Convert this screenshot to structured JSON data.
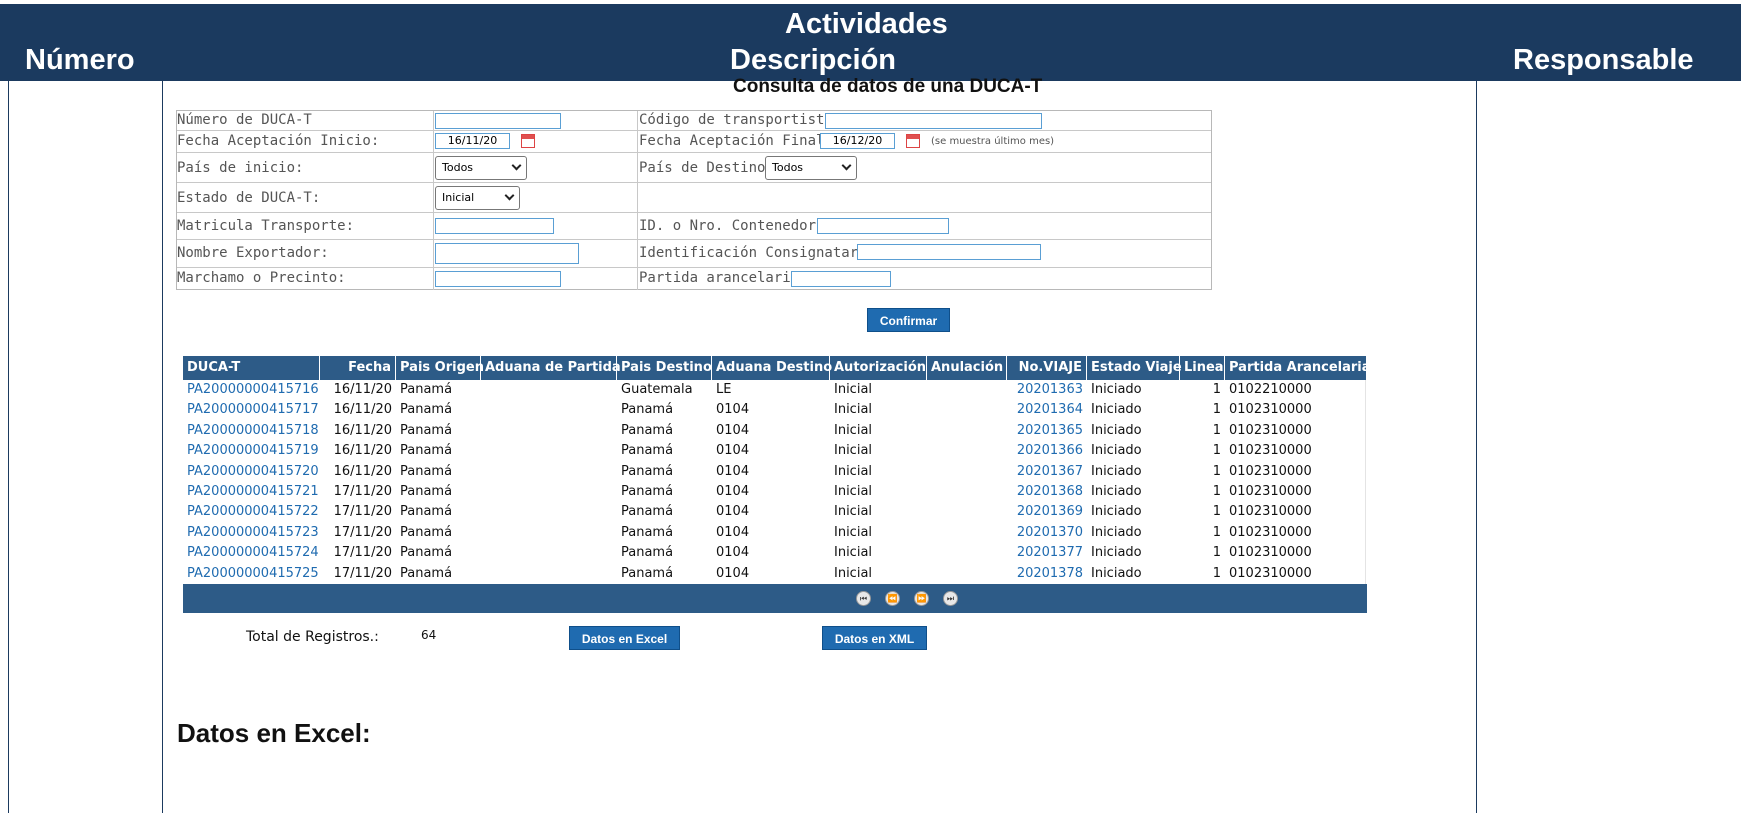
{
  "header": {
    "numero": "Número",
    "actividades": "Actividades",
    "descripcion": "Descripción",
    "responsable": "Responsable"
  },
  "page_title": "Consulta de datos de una DUCA-T",
  "form": {
    "numero_duca_label": "Número de DUCA-T",
    "numero_duca_value": "",
    "codigo_transportista_label": "Código de transportista:",
    "codigo_transportista_value": "",
    "fecha_inicio_label": "Fecha Aceptación Inicio:",
    "fecha_inicio_value": "16/11/20",
    "fecha_final_label": "Fecha Aceptación Final:",
    "fecha_final_value": "16/12/20",
    "fecha_hint": "(se muestra último mes)",
    "pais_inicio_label": "País de inicio:",
    "pais_inicio_value": "Todos",
    "pais_destino_label": "País de Destino:",
    "pais_destino_value": "Todos",
    "estado_label": "Estado de DUCA-T:",
    "estado_value": "Inicial",
    "matricula_label": "Matricula Transporte:",
    "matricula_value": "",
    "contenedor_label": "ID. o Nro. Contenedor:",
    "contenedor_value": "",
    "exportador_label": "Nombre Exportador:",
    "exportador_value": "",
    "consignatario_label": "Identificación Consignatario:",
    "consignatario_value": "",
    "marchamo_label": "Marchamo o Precinto:",
    "marchamo_value": "",
    "partida_label": "Partida arancelaria:",
    "partida_value": ""
  },
  "confirm_button": "Confirmar",
  "grid": {
    "columns": [
      "DUCA-T",
      "Fecha",
      "Pais Origen",
      "Aduana de Partida",
      "Pais Destino",
      "Aduana Destino",
      "Autorización",
      "Anulación",
      "No.VIAJE",
      "Estado Viaje",
      "Linea",
      "Partida Arancelaria"
    ],
    "rows": [
      [
        "PA20000000415716",
        "16/11/20",
        "Panamá",
        "",
        "Guatemala",
        "LE",
        "Inicial",
        "",
        "20201363",
        "Iniciado",
        "1",
        "0102210000"
      ],
      [
        "PA20000000415717",
        "16/11/20",
        "Panamá",
        "",
        "Panamá",
        "0104",
        "Inicial",
        "",
        "20201364",
        "Iniciado",
        "1",
        "0102310000"
      ],
      [
        "PA20000000415718",
        "16/11/20",
        "Panamá",
        "",
        "Panamá",
        "0104",
        "Inicial",
        "",
        "20201365",
        "Iniciado",
        "1",
        "0102310000"
      ],
      [
        "PA20000000415719",
        "16/11/20",
        "Panamá",
        "",
        "Panamá",
        "0104",
        "Inicial",
        "",
        "20201366",
        "Iniciado",
        "1",
        "0102310000"
      ],
      [
        "PA20000000415720",
        "16/11/20",
        "Panamá",
        "",
        "Panamá",
        "0104",
        "Inicial",
        "",
        "20201367",
        "Iniciado",
        "1",
        "0102310000"
      ],
      [
        "PA20000000415721",
        "17/11/20",
        "Panamá",
        "",
        "Panamá",
        "0104",
        "Inicial",
        "",
        "20201368",
        "Iniciado",
        "1",
        "0102310000"
      ],
      [
        "PA20000000415722",
        "17/11/20",
        "Panamá",
        "",
        "Panamá",
        "0104",
        "Inicial",
        "",
        "20201369",
        "Iniciado",
        "1",
        "0102310000"
      ],
      [
        "PA20000000415723",
        "17/11/20",
        "Panamá",
        "",
        "Panamá",
        "0104",
        "Inicial",
        "",
        "20201370",
        "Iniciado",
        "1",
        "0102310000"
      ],
      [
        "PA20000000415724",
        "17/11/20",
        "Panamá",
        "",
        "Panamá",
        "0104",
        "Inicial",
        "",
        "20201377",
        "Iniciado",
        "1",
        "0102310000"
      ],
      [
        "PA20000000415725",
        "17/11/20",
        "Panamá",
        "",
        "Panamá",
        "0104",
        "Inicial",
        "",
        "20201378",
        "Iniciado",
        "1",
        "0102310000"
      ]
    ],
    "pager_icons": [
      "first-page-icon",
      "prev-page-icon",
      "next-page-icon",
      "last-page-icon"
    ]
  },
  "totals": {
    "label": "Total de Registros.:",
    "value": "64"
  },
  "excel_button": "Datos en Excel",
  "xml_button": "Datos en XML",
  "excel_heading": "Datos en Excel:",
  "colors": {
    "header_bg": "#1b3a5f",
    "grid_header_bg": "#2d5b87",
    "button_bg": "#1f6bb0",
    "link": "#1f6bb0"
  }
}
